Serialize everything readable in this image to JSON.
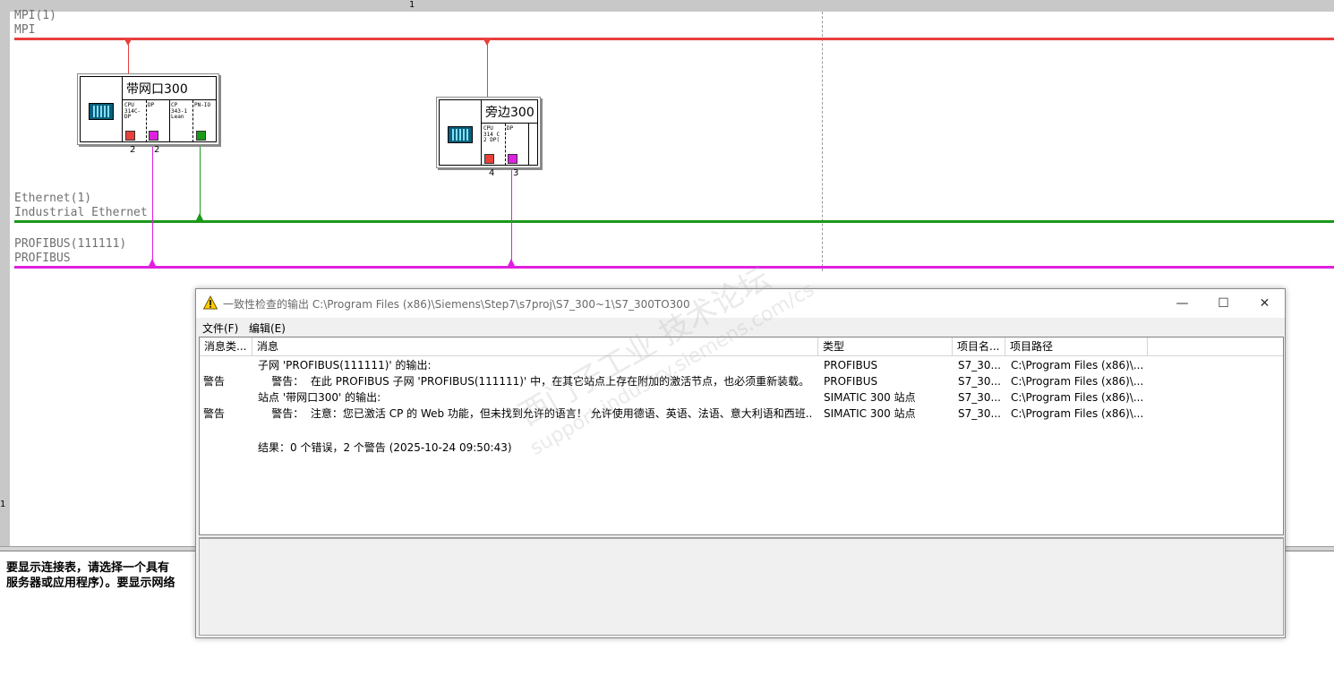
{
  "ruler": {
    "top_mark": "1",
    "left_mark": "1"
  },
  "networks": {
    "mpi": {
      "name": "MPI(1)",
      "type": "MPI",
      "color": "#e8403c"
    },
    "ethernet": {
      "name": "Ethernet(1)",
      "type": "Industrial Ethernet",
      "color": "#1a9a1a"
    },
    "profibus": {
      "name": "PROFIBUS(111111)",
      "type": "PROFIBUS",
      "color": "#e020e0"
    }
  },
  "stations": [
    {
      "title": "带网口300",
      "slots": [
        "CPU\n314C-\nDP",
        "DP",
        "CP\n343-1\nLean",
        "PN-IO"
      ],
      "ports": [
        "2",
        "2"
      ]
    },
    {
      "title": "旁边300",
      "slots": [
        "CPU\n314 C\n2 DP(",
        "DP"
      ],
      "ports": [
        "4",
        "3"
      ]
    }
  ],
  "bottom_text": "要显示连接表，请选择一个具有\n服务器或应用程序）。要显示网络",
  "dialog": {
    "title": "一致性检查的输出  C:\\Program Files (x86)\\Siemens\\Step7\\s7proj\\S7_300~1\\S7_300TO300",
    "controls": {
      "minimize": "—",
      "maximize": "☐",
      "close": "✕"
    },
    "menu": [
      "文件(F)",
      "编辑(E)"
    ],
    "columns": [
      "消息类...",
      "消息",
      "类型",
      "项目名...",
      "项目路径"
    ],
    "rows": [
      {
        "kind": "",
        "message": "子网 'PROFIBUS(111111)' 的输出:",
        "type": "PROFIBUS",
        "project": "S7_30...",
        "path": "C:\\Program Files (x86)\\..."
      },
      {
        "kind": "警告",
        "message": "    警告：  在此 PROFIBUS 子网 'PROFIBUS(111111)' 中，在其它站点上存在附加的激活节点，也必须重新装载。",
        "type": "PROFIBUS",
        "project": "S7_30...",
        "path": "C:\\Program Files (x86)\\..."
      },
      {
        "kind": "",
        "message": "站点 '带网口300' 的输出:",
        "type": "SIMATIC 300 站点",
        "project": "S7_30...",
        "path": "C:\\Program Files (x86)\\..."
      },
      {
        "kind": "警告",
        "message": "    警告：  注意：您已激活 CP 的 Web 功能，但未找到允许的语言！ 允许使用德语、英语、法语、意大利语和西班...",
        "type": "SIMATIC 300 站点",
        "project": "S7_30...",
        "path": "C:\\Program Files (x86)\\..."
      }
    ],
    "result": "结果：0 个错误，2 个警告 (2025-10-24 09:50:43)"
  },
  "watermark": {
    "line1": "西门子工业 技术论坛",
    "line2": "support.industry.siemens.com/cs"
  }
}
